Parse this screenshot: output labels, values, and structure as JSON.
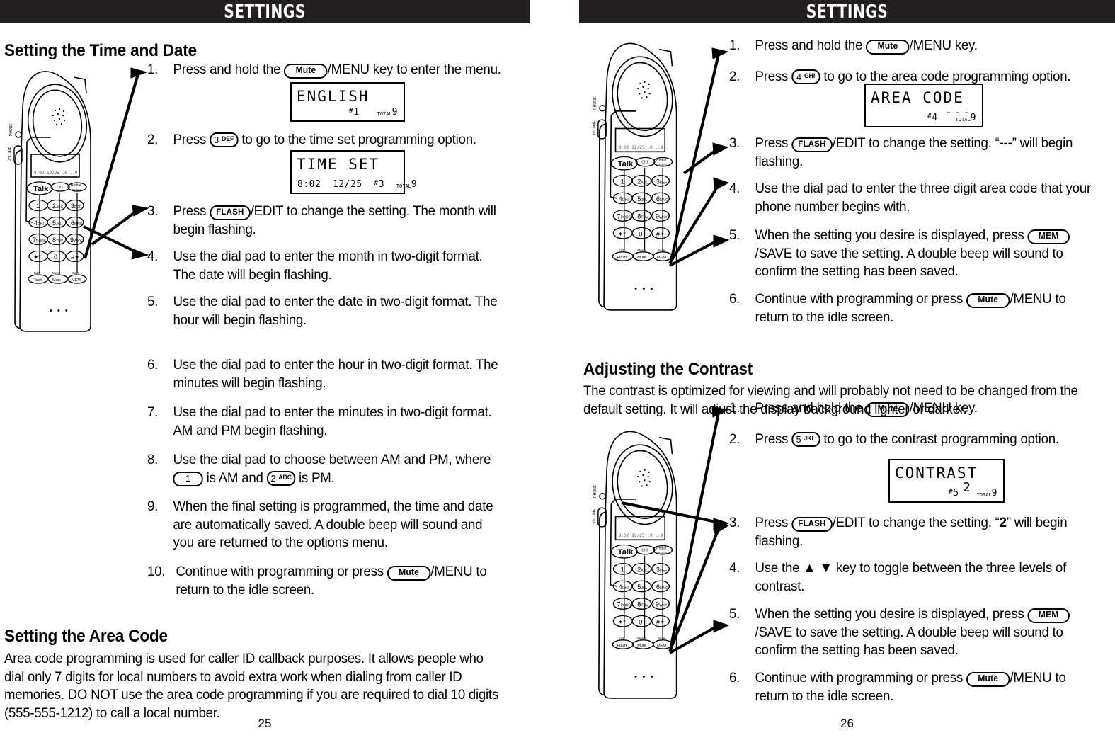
{
  "banner": {
    "title": "SETTINGS"
  },
  "left_page": {
    "page_number": "25",
    "section1": {
      "heading": "Setting the Time and Date",
      "steps": [
        {
          "num": "1.",
          "text": "Press and hold the ⟦Mute⟧/MENU key to enter the menu."
        },
        {
          "num": "2.",
          "text": "Press ⟦3 DEF⟧ to go to the time set programming option."
        },
        {
          "num": "3.",
          "text": "Press ⟦FLASH⟧/EDIT to change the setting.  The month will begin flashing."
        },
        {
          "num": "4.",
          "text": "Use the dial pad to enter the month in two-digit format.  The date will begin flashing."
        },
        {
          "num": "5.",
          "text": "Use the dial pad to enter the date in two-digit format.  The hour will begin flashing."
        },
        {
          "num": "6.",
          "text": "Use the dial pad to enter the hour in two-digit format.  The minutes will begin flashing."
        },
        {
          "num": "7.",
          "text": "Use the dial pad to enter the minutes in two-digit format.  AM and PM begin flashing."
        },
        {
          "num": "8.",
          "text": "Use the dial pad to choose between AM and PM, where ⟦1⟧ is AM and ⟦2 ABC⟧ is PM."
        },
        {
          "num": "9.",
          "text": "When the final setting is programmed, the time and date are automatically saved.  A double beep will sound and you are returned to the options menu."
        },
        {
          "num": "10.",
          "text": "Continue with programming or press ⟦Mute⟧/MENU to return to the idle screen."
        }
      ],
      "lcd_english": {
        "line1": "ENGLISH",
        "index": "#1",
        "total_label": "TOTAL",
        "total": "9"
      },
      "lcd_timeset": {
        "line1": "TIME SET",
        "time": "8:02",
        "date": "12/25",
        "index": "#3",
        "total_label": "TOTAL",
        "total": "9"
      }
    },
    "section2": {
      "heading": "Setting the Area Code",
      "body": "Area code programming is used for caller ID callback purposes.  It allows people who dial only 7 digits for local numbers to avoid extra work when dialing from caller ID memories.  DO NOT use the area code programming if you are required to dial 10 digits (555-555-1212) to call a local number."
    }
  },
  "right_page": {
    "page_number": "26",
    "section1": {
      "steps": [
        {
          "num": "1.",
          "text": "Press and hold the ⟦Mute⟧/MENU key."
        },
        {
          "num": "2.",
          "text": "Press ⟦4 GHI⟧ to go to the area code programming option."
        },
        {
          "num": "3.",
          "text": "Press ⟦FLASH⟧/EDIT to change the setting.  “---” will begin flashing."
        },
        {
          "num": "4.",
          "text": "Use the dial pad to enter the three digit area code that your phone number begins with."
        },
        {
          "num": "5.",
          "text": "When the setting you desire is displayed, press ⟦MEM⟧/SAVE to save the setting.  A double beep will sound to confirm the setting has been saved."
        },
        {
          "num": "6.",
          "text": "Continue with programming or press ⟦Mute⟧/MENU to return to the idle screen."
        }
      ],
      "lcd_areacode": {
        "line1": "AREA CODE",
        "value": "---",
        "index": "#4",
        "total_label": "TOTAL",
        "total": "9"
      }
    },
    "section2": {
      "heading": "Adjusting the Contrast",
      "body": "The contrast is optimized for viewing and will probably not need to be changed from the default setting.  It will adjust the display background lighter or darker.",
      "steps": [
        {
          "num": "1.",
          "text": "Press and hold the ⟦Mute⟧/MENU key."
        },
        {
          "num": "2.",
          "text": "Press ⟦5 JKL⟧ to go to the contrast programming option."
        },
        {
          "num": "3.",
          "text": "Press ⟦FLASH⟧/EDIT to change the setting.  “2” will begin flashing."
        },
        {
          "num": "4.",
          "text": "Use the ▲ ▼ key to toggle between the three levels of contrast."
        },
        {
          "num": "5.",
          "text": "When the setting you desire is displayed, press ⟦MEM⟧/SAVE to save the setting.  A double beep will sound to confirm the setting has been saved."
        },
        {
          "num": "6.",
          "text": "Continue with programming or press ⟦Mute⟧/MENU to return to the idle screen."
        }
      ],
      "lcd_contrast": {
        "line1": "CONTRAST",
        "value": "2",
        "index": "#5",
        "total_label": "TOTAL",
        "total": "9"
      }
    }
  },
  "keys": {
    "mute": "Mute",
    "flash": "FLASH",
    "mem": "MEM",
    "dial_1": "1",
    "dial_2": "2",
    "dial_2_letters": "ABC",
    "dial_3": "3",
    "dial_3_letters": "DEF",
    "dial_4": "4",
    "dial_4_letters": "GHI",
    "dial_5": "5",
    "dial_5_letters": "JKL"
  },
  "phone_illustration": {
    "keypad": [
      [
        "Talk",
        "CID",
        "Redial"
      ],
      [
        "1",
        "2ABC",
        "3DEF"
      ],
      [
        "4GHI",
        "5JKL",
        "6MNO"
      ],
      [
        "7PQRS",
        "8TUV",
        "9WXYZ"
      ],
      [
        "*",
        "0",
        "#"
      ],
      [
        "Flash",
        "Mute",
        "MEM"
      ]
    ],
    "key_sublabels": [
      "Edit",
      "Menu",
      "Save"
    ],
    "redial_sublabel": "Delete",
    "side_labels": [
      "PHONE",
      "VOLUME"
    ],
    "lcd_text": "8:02 12/25"
  },
  "colors": {
    "banner_bg": "#231f20",
    "text": "#000000",
    "page_bg": "#ffffff"
  }
}
